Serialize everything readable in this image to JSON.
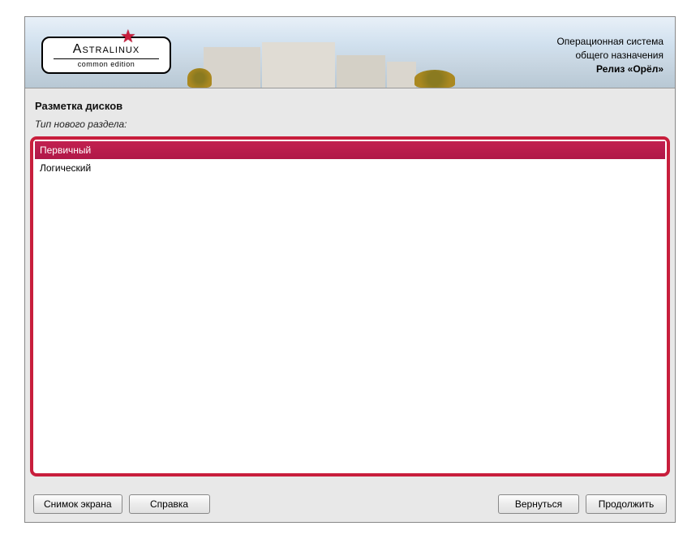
{
  "logo": {
    "brand": "Astralinux",
    "edition": "common edition",
    "reg": "®"
  },
  "banner": {
    "line1": "Операционная система",
    "line2": "общего назначения",
    "line3": "Релиз «Орёл»"
  },
  "content": {
    "heading": "Разметка дисков",
    "prompt": "Тип нового раздела:",
    "options": {
      "0": "Первичный",
      "1": "Логический"
    },
    "selected_index": 0
  },
  "buttons": {
    "screenshot": "Снимок экрана",
    "help": "Справка",
    "back": "Вернуться",
    "continue": "Продолжить"
  }
}
